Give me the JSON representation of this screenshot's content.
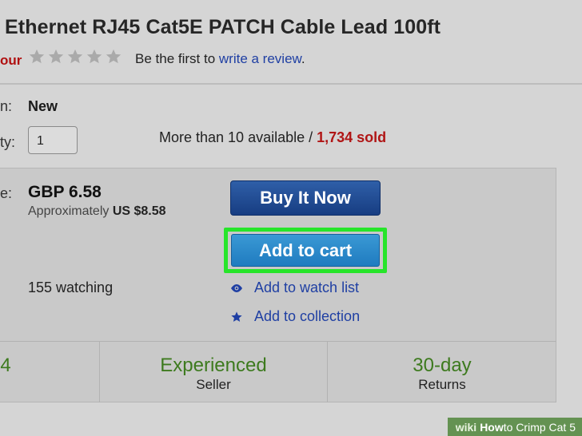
{
  "product": {
    "title": "Ethernet RJ45 Cat5E PATCH Cable Lead 100ft",
    "red_fragment": "our"
  },
  "rating": {
    "stars": 5,
    "rating_value": 0,
    "prefix": "Be the first to ",
    "link": "write a review",
    "suffix": "."
  },
  "details": {
    "condition_label_fragment": "n:",
    "condition_value": "New",
    "quantity_label_fragment": "ty:",
    "quantity_value": "1",
    "available_text": "More than 10 available / ",
    "sold_text": "1,734 sold"
  },
  "purchase": {
    "price_label_fragment": "e:",
    "price": "GBP 6.58",
    "approx_prefix": "Approximately ",
    "approx_value": "US $8.58",
    "buy_now": "Buy It Now",
    "add_to_cart": "Add to cart",
    "watching": "155 watching",
    "watch_list": "Add to watch list",
    "collection": "Add to collection"
  },
  "stats": [
    {
      "big": "4",
      "small": ""
    },
    {
      "big": "Experienced",
      "small": "Seller"
    },
    {
      "big": "30-day",
      "small": "Returns"
    }
  ],
  "footer": {
    "wiki": "wiki",
    "how": "How",
    "rest": " to Crimp Cat 5"
  },
  "colors": {
    "buy_button": "#1f4b94",
    "cart_button": "#2a8ccc",
    "highlight": "#27e52a",
    "link": "#1f3fa3",
    "sold": "#b01515",
    "stat_green": "#3d7a1e"
  }
}
